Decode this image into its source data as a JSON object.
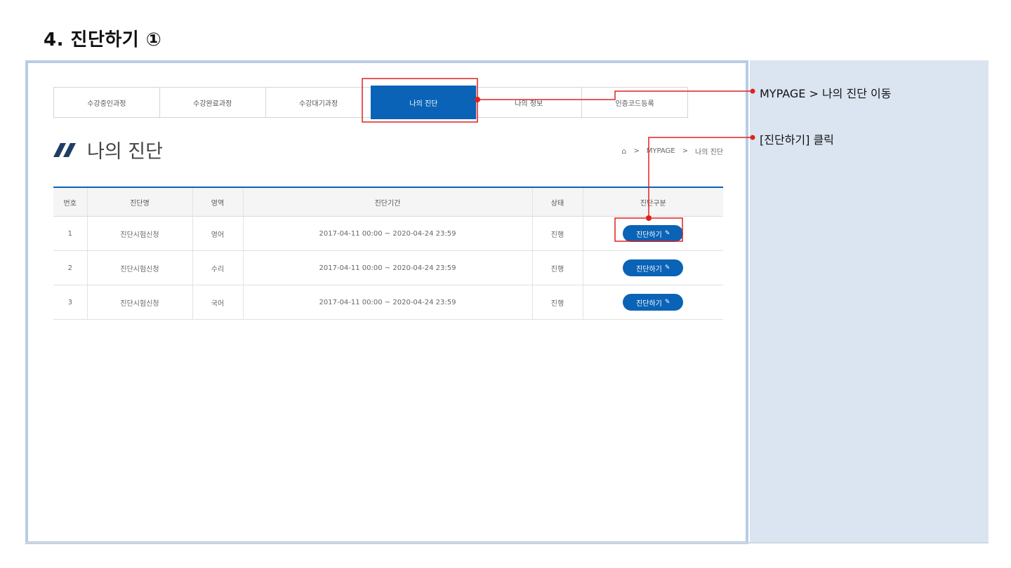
{
  "heading": "4. 진단하기 ①",
  "tabs": [
    {
      "label": "수강중인과정"
    },
    {
      "label": "수강완료과정"
    },
    {
      "label": "수강대기과정"
    },
    {
      "label": "나의 진단"
    },
    {
      "label": "나의 정보"
    },
    {
      "label": "인증코드등록"
    }
  ],
  "section": {
    "title": "나의 진단"
  },
  "breadcrumb": {
    "items": [
      "MYPAGE",
      "나의 진단"
    ],
    "separator": ">"
  },
  "table": {
    "headers": [
      "번호",
      "진단명",
      "영역",
      "진단기간",
      "상태",
      "진단구분"
    ],
    "rows": [
      {
        "no": "1",
        "name": "진단시험신청",
        "area": "영어",
        "period": "2017-04-11 00:00 ~ 2020-04-24 23:59",
        "status": "진행",
        "button": "진단하기"
      },
      {
        "no": "2",
        "name": "진단시험신청",
        "area": "수리",
        "period": "2017-04-11 00:00 ~ 2020-04-24 23:59",
        "status": "진행",
        "button": "진단하기"
      },
      {
        "no": "3",
        "name": "진단시험신청",
        "area": "국어",
        "period": "2017-04-11 00:00 ~ 2020-04-24 23:59",
        "status": "진행",
        "button": "진단하기"
      }
    ]
  },
  "notes": {
    "note1": "MYPAGE > 나의 진단 이동",
    "note2": "[진단하기] 클릭"
  },
  "colors": {
    "accent": "#0a63b6",
    "highlight": "#e02020",
    "frame": "#b8cce4",
    "panel": "#dbe5f1"
  }
}
